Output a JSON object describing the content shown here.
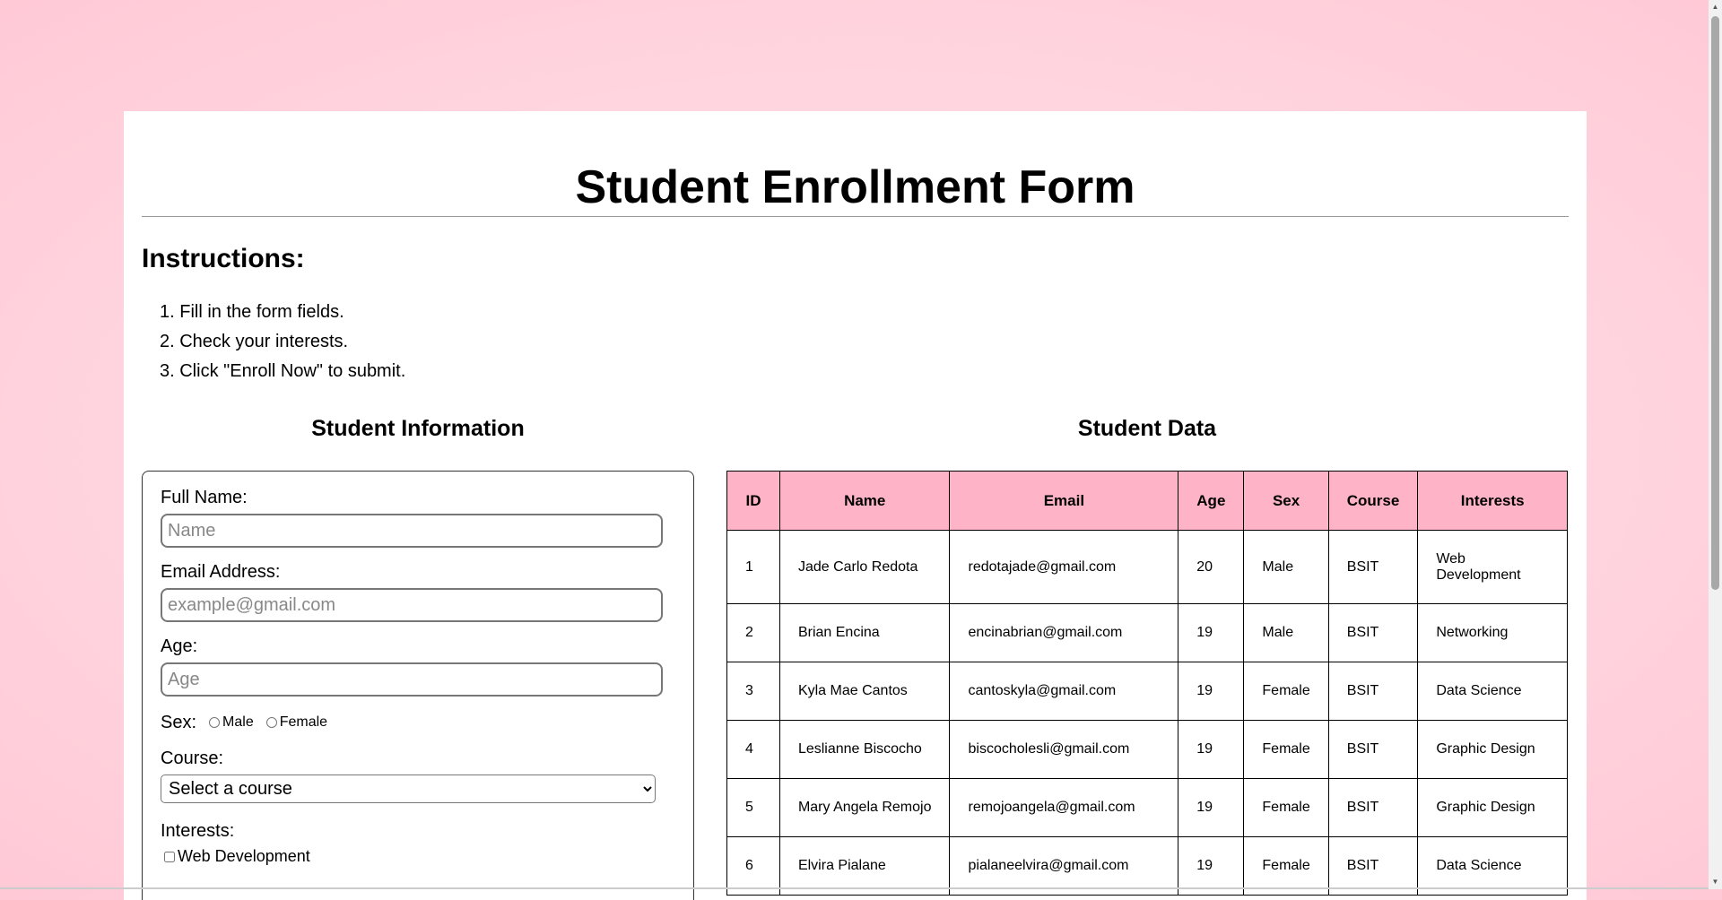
{
  "page": {
    "title": "Student Enrollment Form",
    "instructions_heading": "Instructions:",
    "instructions": [
      "1. Fill in the form fields.",
      "2. Check your interests.",
      "3. Click \"Enroll Now\" to submit."
    ]
  },
  "form": {
    "heading": "Student Information",
    "full_name_label": "Full Name:",
    "full_name_placeholder": "Name",
    "email_label": "Email Address:",
    "email_placeholder": "example@gmail.com",
    "age_label": "Age:",
    "age_placeholder": "Age",
    "sex_label": "Sex:",
    "sex_male": "Male",
    "sex_female": "Female",
    "course_label": "Course:",
    "course_selected": "Select a course",
    "interests_label": "Interests:",
    "interest_1": "Web Development"
  },
  "table": {
    "heading": "Student Data",
    "columns": [
      "ID",
      "Name",
      "Email",
      "Age",
      "Sex",
      "Course",
      "Interests"
    ],
    "rows": [
      [
        "1",
        "Jade Carlo Redota",
        "redotajade@gmail.com",
        "20",
        "Male",
        "BSIT",
        "Web Development"
      ],
      [
        "2",
        "Brian Encina",
        "encinabrian@gmail.com",
        "19",
        "Male",
        "BSIT",
        "Networking"
      ],
      [
        "3",
        "Kyla Mae Cantos",
        "cantoskyla@gmail.com",
        "19",
        "Female",
        "BSIT",
        "Data Science"
      ],
      [
        "4",
        "Leslianne Biscocho",
        "biscocholesli@gmail.com",
        "19",
        "Female",
        "BSIT",
        "Graphic Design"
      ],
      [
        "5",
        "Mary Angela Remojo",
        "remojoangela@gmail.com",
        "19",
        "Female",
        "BSIT",
        "Graphic Design"
      ],
      [
        "6",
        "Elvira Pialane",
        "pialaneelvira@gmail.com",
        "19",
        "Female",
        "BSIT",
        "Data Science"
      ]
    ]
  },
  "colors": {
    "page_bg": "#ffd6e0",
    "table_header_bg": "#ffb3c6"
  },
  "icons": {
    "scroll_up": "triangle-up-icon",
    "scroll_down": "triangle-down-icon"
  }
}
